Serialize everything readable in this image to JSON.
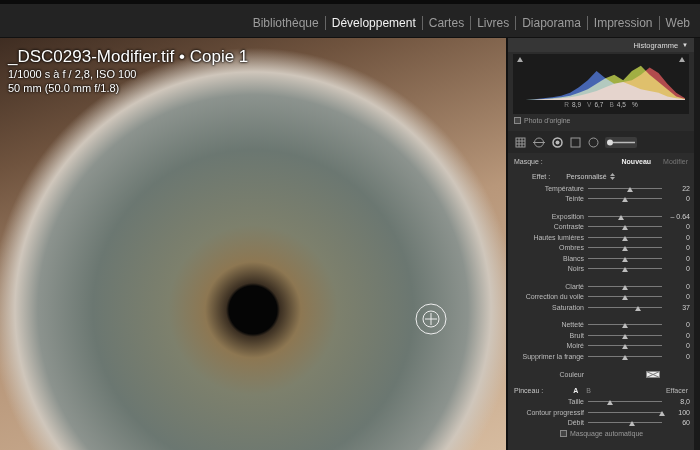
{
  "modules": [
    {
      "label": "Bibliothèque",
      "selected": false
    },
    {
      "label": "Développement",
      "selected": true
    },
    {
      "label": "Cartes",
      "selected": false
    },
    {
      "label": "Livres",
      "selected": false
    },
    {
      "label": "Diaporama",
      "selected": false
    },
    {
      "label": "Impression",
      "selected": false
    },
    {
      "label": "Web",
      "selected": false
    }
  ],
  "photo": {
    "filename": "_DSC0293-Modifier.tif • Copie 1",
    "exposure": "1/1000 s à f / 2,8, ISO 100",
    "lens": "50 mm (50.0 mm f/1.8)"
  },
  "histogram": {
    "title": "Histogramme",
    "toggle": "▼",
    "series": [
      {
        "name": "blue",
        "color": "#3f6fe0",
        "values": [
          0,
          0,
          0.02,
          0.05,
          0.08,
          0.12,
          0.2,
          0.35,
          0.55,
          0.8,
          0.6,
          0.45,
          0.5,
          0.4,
          0.3,
          0.25,
          0.2,
          0.1,
          0.05,
          0.02
        ]
      },
      {
        "name": "green",
        "color": "#c8dc3c",
        "values": [
          0,
          0,
          0.01,
          0.03,
          0.05,
          0.08,
          0.12,
          0.2,
          0.3,
          0.45,
          0.6,
          0.7,
          0.55,
          0.8,
          0.95,
          0.7,
          0.5,
          0.3,
          0.1,
          0.03
        ]
      },
      {
        "name": "red",
        "color": "#e0484a",
        "values": [
          0,
          0,
          0,
          0.02,
          0.03,
          0.05,
          0.08,
          0.12,
          0.18,
          0.25,
          0.35,
          0.45,
          0.5,
          0.55,
          0.7,
          0.9,
          0.75,
          0.45,
          0.2,
          0.05
        ]
      }
    ],
    "readout": [
      {
        "label": "R",
        "value": "8,9"
      },
      {
        "label": "V",
        "value": "6,7"
      },
      {
        "label": "B",
        "value": "4,5"
      }
    ],
    "unit": "%",
    "original_photo": {
      "label": "Photo d'origine",
      "checked": false
    }
  },
  "tools": [
    {
      "kind": "grid",
      "selected": false
    },
    {
      "kind": "spot",
      "selected": false
    },
    {
      "kind": "redeye",
      "selected": false
    },
    {
      "kind": "graduated",
      "selected": false
    },
    {
      "kind": "radial",
      "selected": false
    },
    {
      "kind": "brush",
      "selected": true
    }
  ],
  "mask": {
    "label": "Masque :",
    "actions": [
      {
        "label": "Nouveau",
        "selected": true
      },
      {
        "label": "Modifier",
        "selected": false
      }
    ]
  },
  "effect": {
    "label": "Effet :",
    "value": "Personnalisé"
  },
  "slider_groups": [
    [
      {
        "label": "Température",
        "value": "22",
        "level": 0.57
      },
      {
        "label": "Teinte",
        "value": "0",
        "level": 0.5
      }
    ],
    [
      {
        "label": "Exposition",
        "value": "– 0.64",
        "level": 0.44
      },
      {
        "label": "Contraste",
        "value": "0",
        "level": 0.5
      },
      {
        "label": "Hautes lumières",
        "value": "0",
        "level": 0.5
      },
      {
        "label": "Ombres",
        "value": "0",
        "level": 0.5
      },
      {
        "label": "Blancs",
        "value": "0",
        "level": 0.5
      },
      {
        "label": "Noirs",
        "value": "0",
        "level": 0.5
      }
    ],
    [
      {
        "label": "Clarté",
        "value": "0",
        "level": 0.5
      },
      {
        "label": "Correction du voile",
        "value": "0",
        "level": 0.5
      },
      {
        "label": "Saturation",
        "value": "37",
        "level": 0.68
      }
    ],
    [
      {
        "label": "Netteté",
        "value": "0",
        "level": 0.5
      },
      {
        "label": "Bruit",
        "value": "0",
        "level": 0.5
      },
      {
        "label": "Moiré",
        "value": "0",
        "level": 0.5
      },
      {
        "label": "Supprimer la frange",
        "value": "0",
        "level": 0.5
      }
    ]
  ],
  "color": {
    "label": "Couleur"
  },
  "brush": {
    "label": "Pinceau :",
    "presets": [
      {
        "label": "A",
        "selected": true
      },
      {
        "label": "B",
        "selected": false
      }
    ],
    "erase": "Effacer",
    "sliders": [
      {
        "label": "Taille",
        "value": "8,0",
        "level": 0.3
      },
      {
        "label": "Contour progressif",
        "value": "100",
        "level": 1
      },
      {
        "label": "Débit",
        "value": "60",
        "level": 0.6
      }
    ],
    "auto_mask": {
      "label": "Masquage automatique",
      "checked": false
    }
  }
}
